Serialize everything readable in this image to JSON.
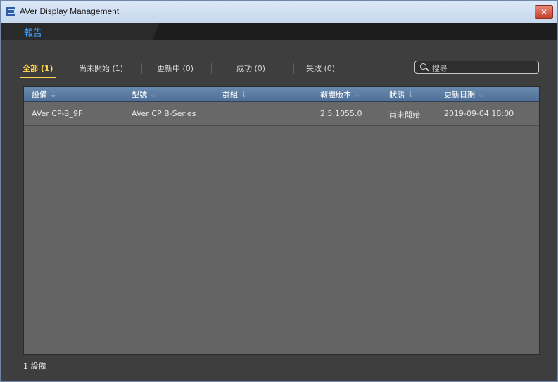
{
  "window": {
    "title": "AVer Display Management"
  },
  "menu": {
    "active_tab": "報告"
  },
  "filters": [
    {
      "label": "全部 (1)",
      "active": true
    },
    {
      "label": "尚未開始 (1)",
      "active": false
    },
    {
      "label": "更新中 (0)",
      "active": false
    },
    {
      "label": "成功 (0)",
      "active": false
    },
    {
      "label": "失敗 (0)",
      "active": false
    }
  ],
  "search": {
    "placeholder": "搜尋"
  },
  "table": {
    "columns": [
      "設備",
      "型號",
      "群組",
      "韌體版本",
      "狀態",
      "更新日期"
    ],
    "rows": [
      {
        "device": "AVer CP-B_9F",
        "model": "AVer CP B-Series",
        "group": "",
        "firmware": "2.5.1055.0",
        "status": "尚未開始",
        "updated": "2019-09-04 18:00"
      }
    ]
  },
  "footer": {
    "count_text": "1 設備"
  },
  "colors": {
    "accent_tab": "#3fa2ff",
    "filter_active": "#ffd34e",
    "header": "#5a7aa0"
  },
  "icons": {
    "close": "close-icon",
    "search": "search-icon",
    "sort": "sort-arrow-icon",
    "app": "app-icon"
  }
}
